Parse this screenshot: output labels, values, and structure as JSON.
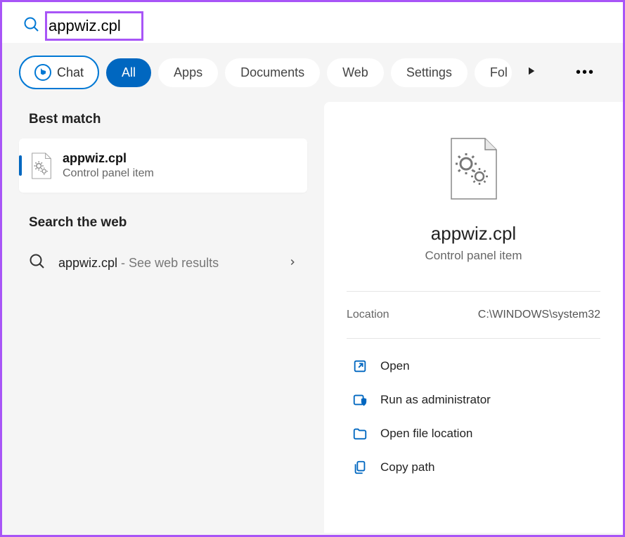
{
  "search": {
    "value": "appwiz.cpl"
  },
  "tabs": {
    "chat": "Chat",
    "items": [
      "All",
      "Apps",
      "Documents",
      "Web",
      "Settings",
      "Fol"
    ]
  },
  "left": {
    "best_match_header": "Best match",
    "best_match": {
      "title": "appwiz.cpl",
      "subtitle": "Control panel item"
    },
    "web_header": "Search the web",
    "web_result": {
      "title": "appwiz.cpl",
      "suffix": " - See web results"
    }
  },
  "right": {
    "title": "appwiz.cpl",
    "subtitle": "Control panel item",
    "location_label": "Location",
    "location_value": "C:\\WINDOWS\\system32",
    "actions": {
      "open": "Open",
      "run_admin": "Run as administrator",
      "open_location": "Open file location",
      "copy_path": "Copy path"
    }
  }
}
